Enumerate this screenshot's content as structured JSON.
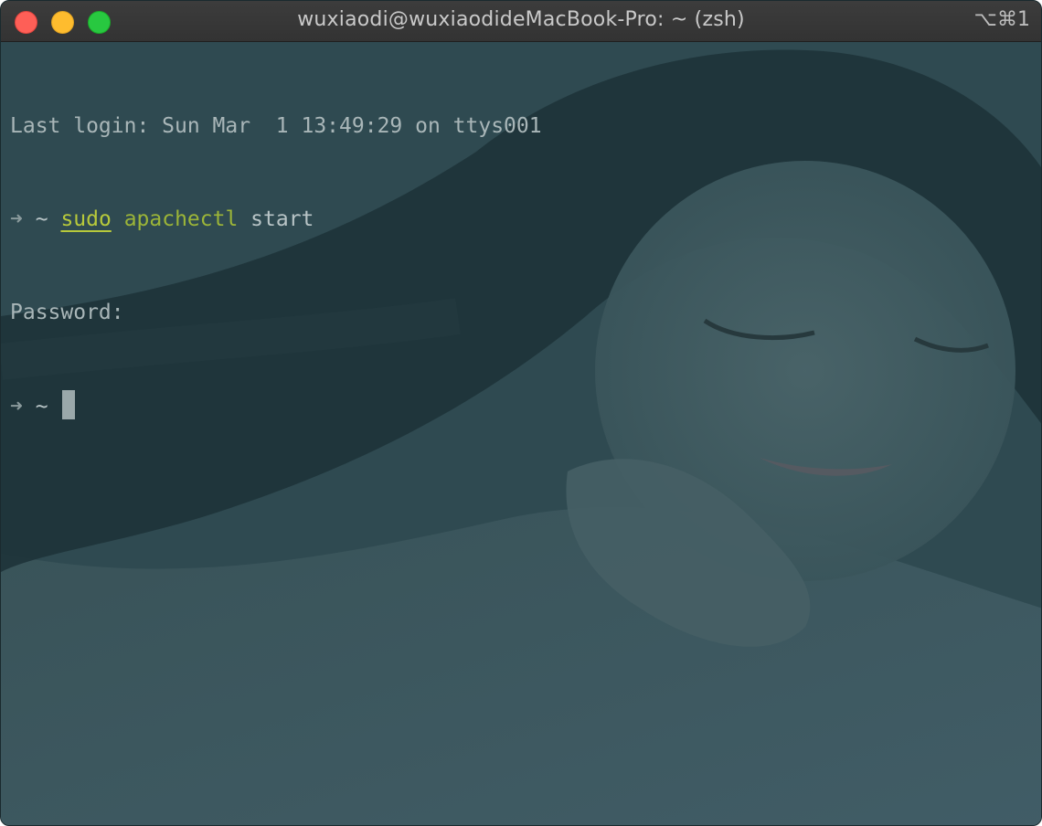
{
  "window": {
    "title": "wuxiaodi@wuxiaodideMacBook-Pro: ~ (zsh)",
    "shortcut": "⌥⌘1"
  },
  "terminal": {
    "last_login": "Last login: Sun Mar  1 13:49:29 on ttys001",
    "prompt_arrow": "➜",
    "prompt_dir": "~",
    "cmd_sudo": "sudo",
    "cmd_apachectl": "apachectl",
    "cmd_arg": "start",
    "password_prompt": "Password:"
  },
  "colors": {
    "background_tint": "#2e4950",
    "command_green": "#9cb538",
    "text": "#a9b6b8"
  }
}
